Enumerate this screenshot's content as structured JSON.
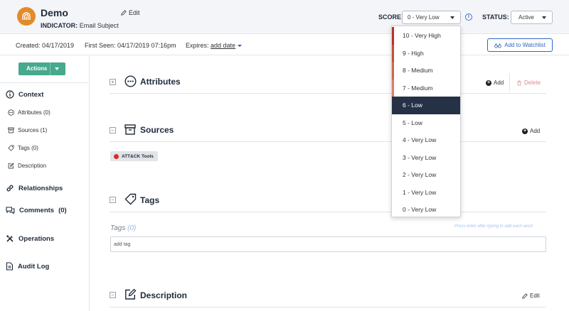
{
  "header": {
    "title": "Demo",
    "edit_label": "Edit",
    "indicator_label": "INDICATOR:",
    "indicator_value": "Email Subject",
    "score_label": "SCORE:",
    "score_value": "0 - Very Low",
    "status_label": "STATUS:",
    "status_value": "Active",
    "info_glyph": "i"
  },
  "meta": {
    "created": "Created: 04/17/2019",
    "first_seen": "First Seen: 04/17/2019 07:16pm",
    "expires_label": "Expires:",
    "expires_link": "add date",
    "watchlist_label": "Add to Watchlist"
  },
  "sidebar": {
    "actions_label": "Actions",
    "context_label": "Context",
    "attributes_label": "Attributes (0)",
    "sources_label": "Sources (1)",
    "tags_label": "Tags (0)",
    "description_label": "Description",
    "relationships_label": "Relationships",
    "comments_label": "Comments",
    "comments_count": "(0)",
    "operations_label": "Operations",
    "audit_log_label": "Audit Log"
  },
  "sections": {
    "attributes_title": "Attributes",
    "sources_title": "Sources",
    "tags_title": "Tags",
    "description_title": "Description",
    "add_label": "Add",
    "delete_label": "Delete",
    "edit_label": "Edit",
    "expand_glyph": "+",
    "collapse_glyph": "−",
    "source_chip": "ATT&CK Tools",
    "tags_field_label": "Tags",
    "tags_field_count": "(0)",
    "tags_hint": "Press enter after typing to add each word",
    "tag_input_placeholder": "add tag"
  },
  "score_dropdown": {
    "selected_index": 4,
    "options": [
      {
        "label": "10 - Very High",
        "color": "#b8322a"
      },
      {
        "label": "9 - High",
        "color": "#c0513a"
      },
      {
        "label": "8 - Medium",
        "color": "#cc6a4a"
      },
      {
        "label": "7 - Medium",
        "color": "#d97f6a"
      },
      {
        "label": "6 - Low",
        "color": ""
      },
      {
        "label": "5 - Low",
        "color": ""
      },
      {
        "label": "4 - Very Low",
        "color": ""
      },
      {
        "label": "3 - Very Low",
        "color": ""
      },
      {
        "label": "2 - Very Low",
        "color": ""
      },
      {
        "label": "1 - Very Low",
        "color": ""
      },
      {
        "label": "0 - Very Low",
        "color": ""
      }
    ]
  },
  "colors": {
    "actions_green": "#47a98d",
    "selected_bg": "#253246",
    "link_blue": "#1f5fb8",
    "logo_orange": "#e28a2c"
  }
}
